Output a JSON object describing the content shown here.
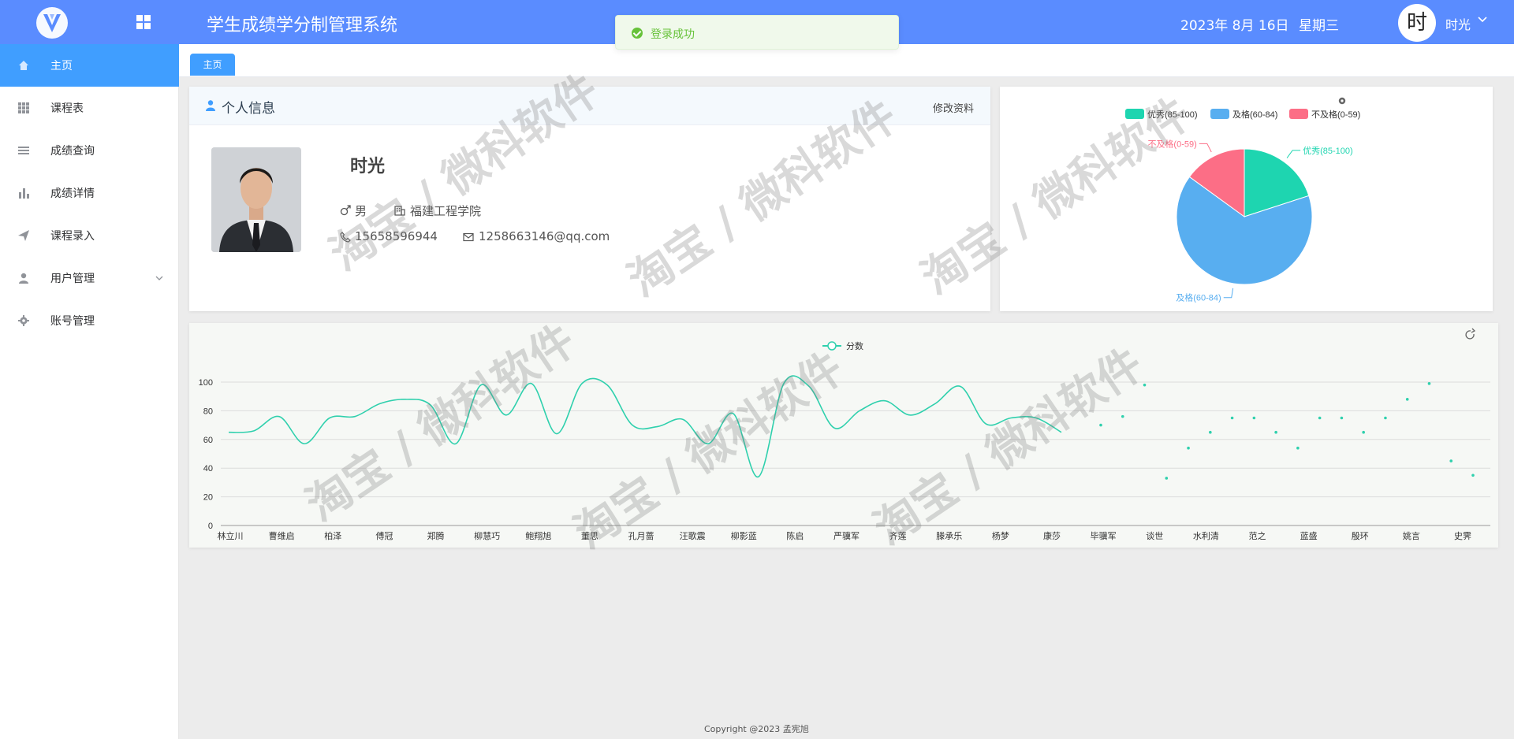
{
  "header": {
    "app_title": "学生成绩学分制管理系统",
    "date": "2023年 8月 16日",
    "weekday": "星期三",
    "avatar_text": "时",
    "user_name": "时光"
  },
  "toast": {
    "message": "登录成功",
    "type": "success",
    "color": "#67c23a"
  },
  "sidebar": {
    "items": [
      {
        "label": "主页",
        "icon": "home-icon",
        "active": true
      },
      {
        "label": "课程表",
        "icon": "grid-icon"
      },
      {
        "label": "成绩查询",
        "icon": "list-icon"
      },
      {
        "label": "成绩详情",
        "icon": "bar-chart-icon"
      },
      {
        "label": "课程录入",
        "icon": "send-icon"
      },
      {
        "label": "用户管理",
        "icon": "user-icon",
        "expandable": true
      },
      {
        "label": "账号管理",
        "icon": "gear-icon"
      }
    ]
  },
  "tabs": [
    {
      "label": "主页",
      "active": true
    }
  ],
  "profile": {
    "card_title": "个人信息",
    "edit_label": "修改资料",
    "name": "时光",
    "gender": "男",
    "school": "福建工程学院",
    "phone": "15658596944",
    "email": "1258663146@qq.com"
  },
  "colors": {
    "header": "#5a8cff",
    "active_menu": "#409eff",
    "excellent": "#1ed5b0",
    "pass": "#58aef0",
    "fail": "#fc6e86",
    "line": "#2fd0ad"
  },
  "watermark": "淘宝 / 微科软件",
  "footer": "Copyright @2023 孟宪旭",
  "chart_data": [
    {
      "type": "pie",
      "legend_position": "top-left",
      "labels": [
        "优秀(85-100)",
        "及格(60-84)",
        "不及格(0-59)"
      ],
      "values": [
        20,
        65,
        15
      ],
      "colors": [
        "#1ed5b0",
        "#58aef0",
        "#fc6e86"
      ]
    },
    {
      "type": "line",
      "legend_position": "top-center",
      "series": [
        {
          "name": "分数"
        }
      ],
      "ylim": [
        0,
        100
      ],
      "yticks": [
        0,
        20,
        40,
        60,
        80,
        100
      ],
      "grid": true,
      "x_tick_labels": [
        "林立川",
        "曹维启",
        "柏泽",
        "傅冠",
        "郑腾",
        "柳慧巧",
        "鲍翔旭",
        "董思",
        "孔月蔷",
        "汪歌震",
        "柳影蓝",
        "陈启",
        "严骥军",
        "齐莲",
        "滕承乐",
        "杨梦",
        "康莎",
        "毕骥军",
        "谈世",
        "水利清",
        "范之",
        "蓝盛",
        "殷环",
        "姚言",
        "史霁"
      ],
      "values": [
        65,
        66,
        76,
        57,
        75,
        76,
        85,
        88,
        84,
        57,
        98,
        77,
        99,
        64,
        99,
        98,
        70,
        69,
        74,
        57,
        78,
        34,
        99,
        97,
        68,
        80,
        87,
        77,
        85,
        97,
        71,
        75,
        75,
        65,
        70,
        76,
        98,
        33,
        54,
        65,
        75,
        75,
        65,
        54,
        75,
        75,
        65,
        75,
        88,
        99,
        45,
        35
      ]
    }
  ]
}
